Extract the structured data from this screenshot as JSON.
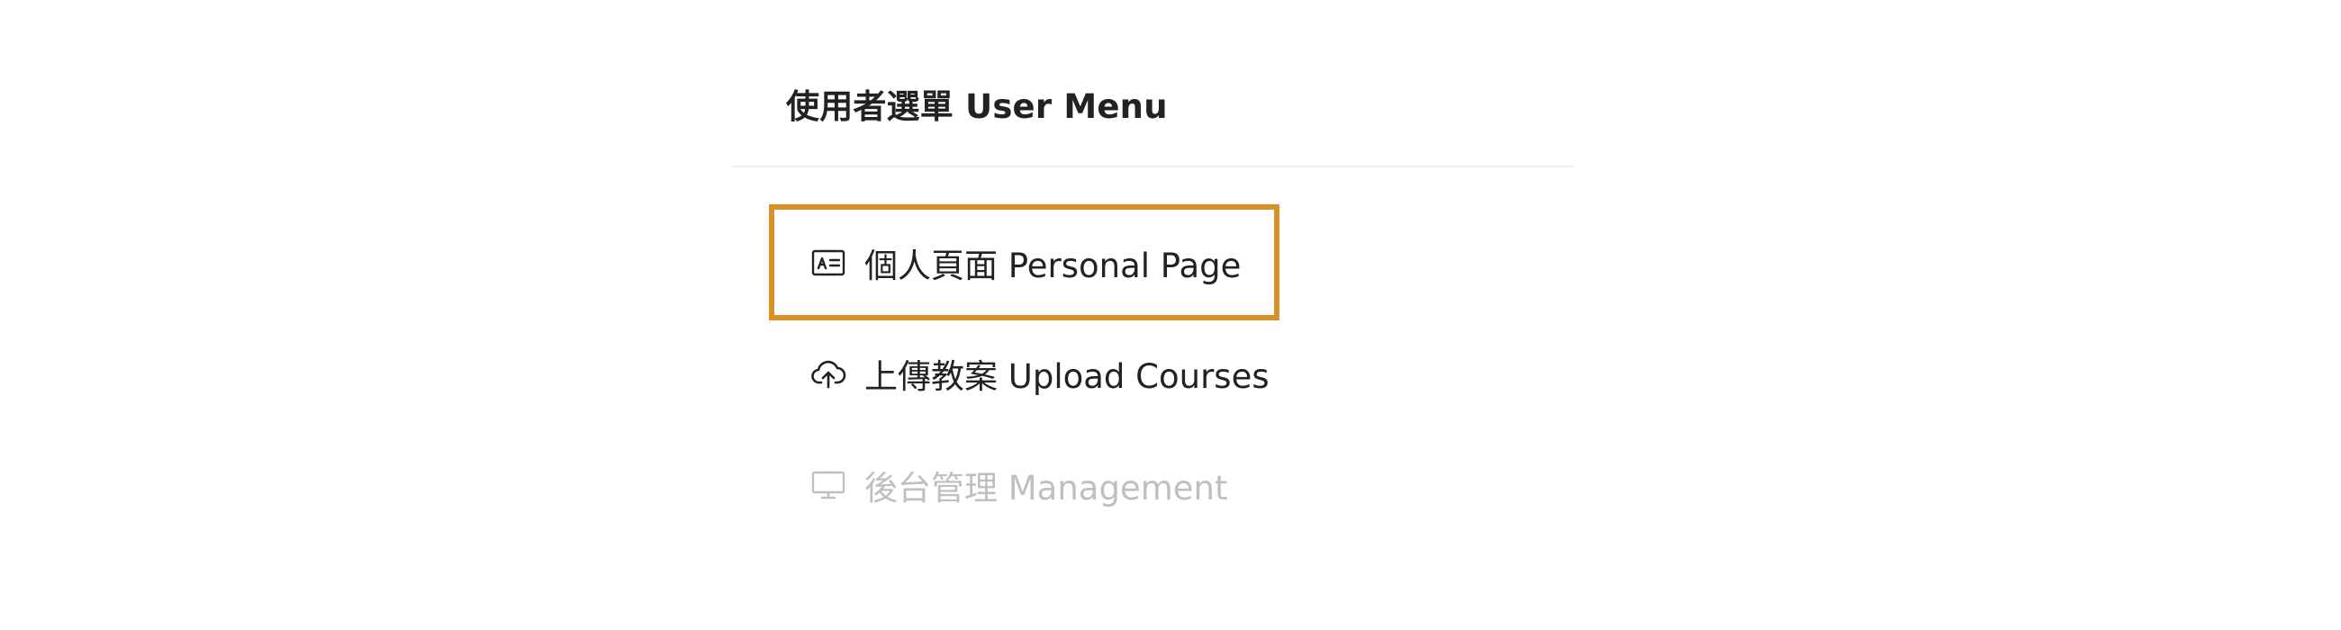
{
  "menu": {
    "title": "使用者選單 User Menu",
    "items": [
      {
        "label": "個人頁面 Personal Page",
        "icon": "id-card-icon",
        "state": "highlighted"
      },
      {
        "label": "上傳教案 Upload Courses",
        "icon": "cloud-upload-icon",
        "state": "enabled"
      },
      {
        "label": "後台管理 Management",
        "icon": "desktop-icon",
        "state": "disabled"
      }
    ]
  },
  "colors": {
    "highlight": "#d99128",
    "text": "#222222",
    "disabled_text": "#bfbfbf",
    "divider": "#eeeeee"
  }
}
